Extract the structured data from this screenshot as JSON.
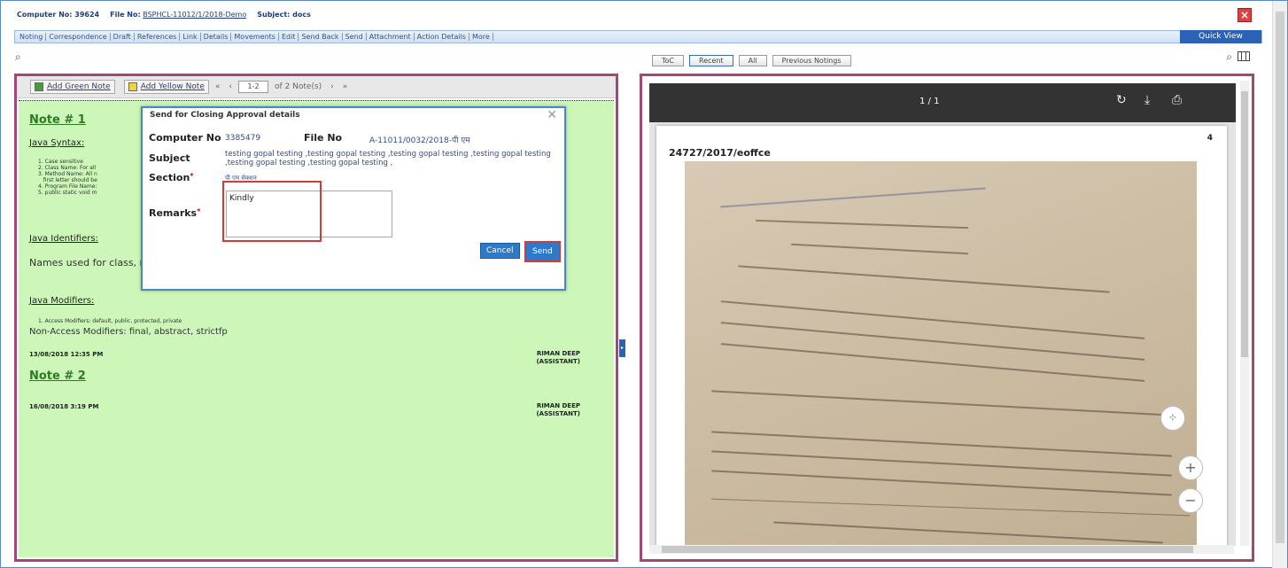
{
  "header": {
    "computer_no": "Computer No: 39624",
    "file_no_label": "File No:",
    "file_no_value": "BSPHCL-11012/1/2018-Demo",
    "subject": "Subject: docs"
  },
  "menu": {
    "items": [
      "Noting",
      "Correspondence",
      "Draft",
      "References",
      "Link",
      "Details",
      "Movements",
      "Edit",
      "Send Back",
      "Send",
      "Attachment",
      "Action Details",
      "More"
    ],
    "quick_view": "Quick View"
  },
  "tabs": [
    "ToC",
    "Recent",
    "All",
    "Previous Notings"
  ],
  "left_toolbar": {
    "add_green": "Add Green Note",
    "add_yellow": "Add Yellow Note",
    "first": "«",
    "prev": "‹",
    "range": "1-2",
    "of_text": "of 2 Note(s)",
    "next": "›",
    "last": "»"
  },
  "notes": {
    "note1_title": "Note # 1",
    "java_syntax": "Java Syntax:",
    "syntax_list": [
      "1. Case sensitive",
      "2. Class Name: For all",
      "3. Method Name: All n",
      "   first letter should be",
      "4. Program File Name:",
      "5. public static void m"
    ],
    "java_identifiers": "Java Identifiers:",
    "identifiers_text": "Names used for class, m",
    "java_modifiers": "Java Modifiers:",
    "access_mod": "1. Access Modifiers: default, public, protected, private",
    "non_access": "Non-Access Modifiers: final, abstract, strictfp",
    "date1": "13/08/2018 12:35 PM",
    "signer1": [
      "RIMAN DEEP",
      "(ASSISTANT)"
    ],
    "note2_title": "Note # 2",
    "date2": "16/08/2018 3:19 PM",
    "signer2": [
      "RIMAN DEEP",
      "(ASSISTANT)"
    ]
  },
  "modal": {
    "title": "Send for Closing Approval details",
    "computer_no_label": "Computer No",
    "computer_no_value": "3385479",
    "file_no_label": "File No",
    "file_no_value": "A-11011/0032/2018-पी एम",
    "subject_label": "Subject",
    "subject_value": "testing gopal testing ,testing gopal testing ,testing gopal testing ,testing gopal testing ,testing gopal testing ,testing gopal testing ,",
    "section_label": "Section",
    "section_value": "पी एम सेक्शन",
    "remarks_label": "Remarks",
    "remarks_value": "Kindly",
    "cancel": "Cancel",
    "send": "Send"
  },
  "pdf": {
    "page_indicator": "1 / 1",
    "page_number": "4",
    "doc_heading": "24727/2017/eoffce"
  }
}
